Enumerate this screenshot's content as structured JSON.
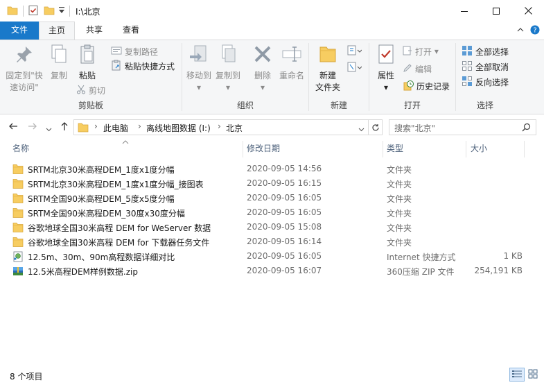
{
  "window": {
    "title": "I:\\北京",
    "controls": [
      "minimize",
      "maximize",
      "close"
    ]
  },
  "tabs": {
    "file": "文件",
    "home": "主页",
    "share": "共享",
    "view": "查看"
  },
  "ribbon": {
    "clipboard": {
      "label": "剪贴板",
      "pin": "固定到\"快速访问\"",
      "pin_line1": "固定到\"快",
      "pin_line2": "速访问\"",
      "copy": "复制",
      "paste": "粘贴",
      "copy_path": "复制路径",
      "paste_shortcut": "粘贴快捷方式",
      "cut": "剪切"
    },
    "organize": {
      "label": "组织",
      "move_to": "移动到",
      "copy_to": "复制到",
      "delete": "删除",
      "rename": "重命名"
    },
    "new": {
      "label": "新建",
      "new_folder_line1": "新建",
      "new_folder_line2": "文件夹"
    },
    "open": {
      "label": "打开",
      "properties": "属性",
      "open": "打开",
      "edit": "编辑",
      "history": "历史记录"
    },
    "select": {
      "label": "选择",
      "select_all": "全部选择",
      "select_none": "全部取消",
      "invert": "反向选择"
    }
  },
  "address": {
    "crumbs": [
      "此电脑",
      "离线地图数据 (I:)",
      "北京"
    ],
    "search_placeholder": "搜索\"北京\""
  },
  "columns": {
    "name": "名称",
    "date": "修改日期",
    "type": "类型",
    "size": "大小"
  },
  "files": [
    {
      "name": "SRTM北京30米高程DEM_1度x1度分幅",
      "date": "2020-09-05 14:56",
      "type": "文件夹",
      "size": "",
      "icon": "folder-icon"
    },
    {
      "name": "SRTM北京30米高程DEM_1度x1度分幅_接图表",
      "date": "2020-09-05 16:15",
      "type": "文件夹",
      "size": "",
      "icon": "folder-icon"
    },
    {
      "name": "SRTM全国90米高程DEM_5度x5度分幅",
      "date": "2020-09-05 16:05",
      "type": "文件夹",
      "size": "",
      "icon": "folder-icon"
    },
    {
      "name": "SRTM全国90米高程DEM_30度x30度分幅",
      "date": "2020-09-05 16:05",
      "type": "文件夹",
      "size": "",
      "icon": "folder-icon"
    },
    {
      "name": "谷歌地球全国30米高程 DEM for WeServer 数据",
      "date": "2020-09-05 15:08",
      "type": "文件夹",
      "size": "",
      "icon": "folder-icon"
    },
    {
      "name": "谷歌地球全国30米高程 DEM for 下载器任务文件",
      "date": "2020-09-05 16:14",
      "type": "文件夹",
      "size": "",
      "icon": "folder-icon"
    },
    {
      "name": "12.5m、30m、90m高程数据详细对比",
      "date": "2020-09-05 16:05",
      "type": "Internet 快捷方式",
      "size": "1 KB",
      "icon": "internet-shortcut-icon"
    },
    {
      "name": "12.5米高程DEM样例数据.zip",
      "date": "2020-09-05 16:07",
      "type": "360压缩 ZIP 文件",
      "size": "254,191 KB",
      "icon": "zip-icon"
    }
  ],
  "status": {
    "count": "8 个项目"
  },
  "colors": {
    "accent": "#1979ca",
    "folder": "#f7cd61",
    "header_text": "#4c607a"
  }
}
